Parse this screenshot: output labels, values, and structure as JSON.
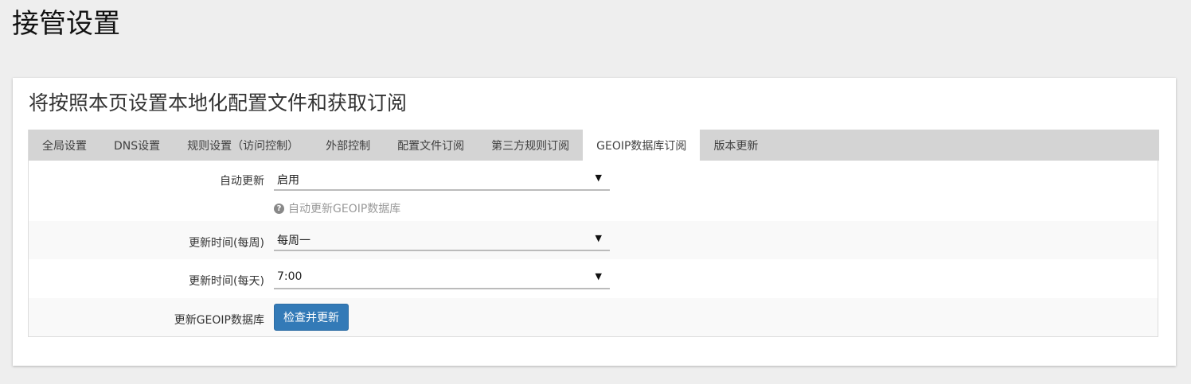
{
  "page": {
    "title": "接管设置"
  },
  "panel": {
    "title": "将按照本页设置本地化配置文件和获取订阅"
  },
  "tabs": [
    {
      "label": "全局设置",
      "active": false
    },
    {
      "label": "DNS设置",
      "active": false
    },
    {
      "label": "规则设置（访问控制）",
      "active": false
    },
    {
      "label": "外部控制",
      "active": false
    },
    {
      "label": "配置文件订阅",
      "active": false
    },
    {
      "label": "第三方规则订阅",
      "active": false
    },
    {
      "label": "GEOIP数据库订阅",
      "active": true
    },
    {
      "label": "版本更新",
      "active": false
    }
  ],
  "form": {
    "auto_update": {
      "label": "自动更新",
      "value": "启用",
      "hint": "自动更新GEOIP数据库"
    },
    "update_weekday": {
      "label": "更新时间(每周)",
      "value": "每周一"
    },
    "update_time": {
      "label": "更新时间(每天)",
      "value": "7:00"
    },
    "update_now": {
      "label": "更新GEOIP数据库",
      "button_label": "检查并更新"
    }
  },
  "icons": {
    "dropdown_arrow": "▼",
    "help": "?"
  },
  "colors": {
    "page_bg": "#eeeeee",
    "tabbar_bg": "#d4d4d4",
    "primary_button": "#337ab7"
  }
}
